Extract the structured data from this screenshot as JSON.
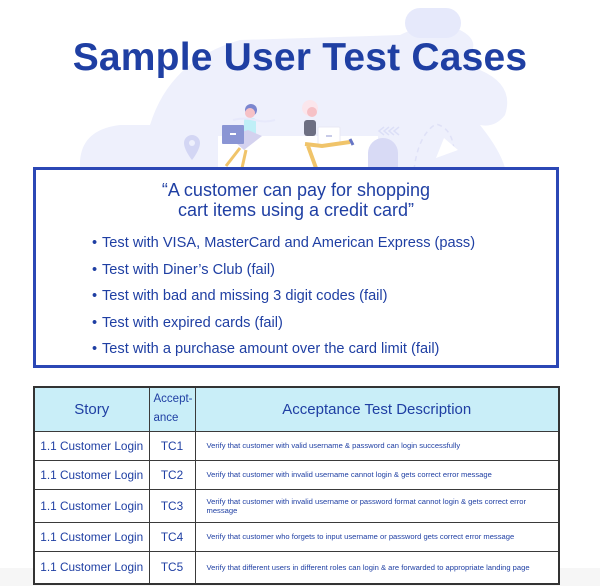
{
  "title": "Sample User Test Cases",
  "illustration": {
    "description": "Two people sitting with laptops",
    "icons": [
      "person-with-laptop-icon",
      "person-with-laptop-icon",
      "location-pin-icon",
      "chevrons-left-icon",
      "paper-plane-icon"
    ]
  },
  "story": {
    "quote_lines": [
      "“A customer can pay for shopping",
      "cart items using a credit card”"
    ],
    "bullet_char": "•",
    "bullets": [
      "Test with VISA, MasterCard and American Express (pass)",
      "Test with Diner’s Club (fail)",
      "Test with bad and missing 3 digit codes (fail)",
      "Test with expired cards (fail)",
      "Test with a purchase amount over the card limit (fail)"
    ]
  },
  "table": {
    "headers": {
      "story": "Story",
      "acceptance_line1": "Accept-",
      "acceptance_line2": "ance",
      "description": "Acceptance Test Description"
    },
    "rows": [
      {
        "story": "1.1 Customer Login",
        "id": "TC1",
        "description": "Verify that customer with valid username & password can login successfully"
      },
      {
        "story": "1.1 Customer Login",
        "id": "TC2",
        "description": "Verify that customer with invalid username cannot login & gets correct error message"
      },
      {
        "story": "1.1 Customer Login",
        "id": "TC3",
        "description": "Verify that customer with invalid username or password format cannot login & gets correct error message"
      },
      {
        "story": "1.1 Customer Login",
        "id": "TC4",
        "description": "Verify that customer who forgets to input username or password gets correct error message"
      },
      {
        "story": "1.1 Customer Login",
        "id": "TC5",
        "description": "Verify that different users in different roles can login & are forwarded to appropriate landing page"
      }
    ]
  },
  "colors": {
    "primary_blue": "#1f3fa3",
    "box_border": "#2b47b5",
    "header_bg": "#c9eef8",
    "illustration_bg": "#eef0fc"
  }
}
